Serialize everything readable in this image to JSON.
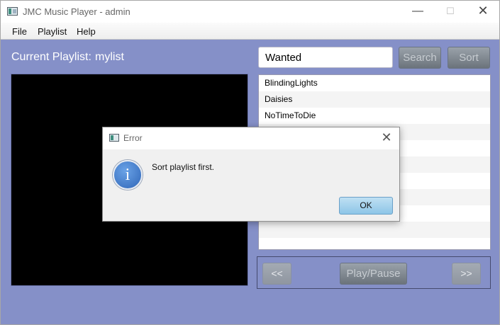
{
  "window": {
    "title": "JMC Music Player - admin",
    "controls": {
      "minimize": "—",
      "maximize": "☐",
      "close": "✕"
    }
  },
  "menu": {
    "items": [
      "File",
      "Playlist",
      "Help"
    ]
  },
  "header": {
    "current_label": "Current Playlist:",
    "playlist_name": "mylist"
  },
  "search": {
    "value": "Wanted",
    "search_label": "Search",
    "sort_label": "Sort"
  },
  "playlist": {
    "songs": [
      "BlindingLights",
      "Daisies",
      "NoTimeToDie",
      "",
      "",
      "",
      "",
      "",
      "",
      "",
      ""
    ]
  },
  "controls": {
    "prev_label": "<<",
    "play_label": "Play/Pause",
    "next_label": ">>"
  },
  "dialog": {
    "title": "Error",
    "message": "Sort playlist first.",
    "ok_label": "OK",
    "close_glyph": "✕",
    "info_glyph": "i"
  },
  "colors": {
    "background": "#8590c8",
    "video": "#000000",
    "ok_button": "#a9d3ee"
  }
}
